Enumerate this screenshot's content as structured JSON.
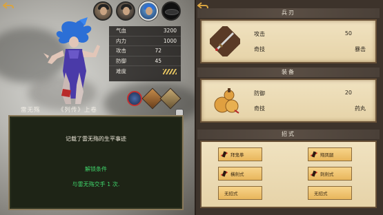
{
  "character": {
    "stats": [
      {
        "label": "气血",
        "value": "3200"
      },
      {
        "label": "内力",
        "value": "1000"
      },
      {
        "label": "攻击",
        "value": "72"
      },
      {
        "label": "防御",
        "value": "45"
      },
      {
        "label": "难度",
        "value": ""
      }
    ],
    "name": "雷无殇",
    "book": "《列传》上卷",
    "description": "记载了雷无殇的生平事迹",
    "unlock_title": "解锁条件",
    "unlock_text": "与雷无殇交手 1 次."
  },
  "portraits": [
    "portrait-1",
    "portrait-2",
    "portrait-3-selected",
    "portrait-4"
  ],
  "weapon": {
    "header": "兵刃",
    "rows": [
      {
        "label": "攻击",
        "value": "50"
      },
      {
        "label": "奇技",
        "value": "暴击"
      }
    ]
  },
  "equipment": {
    "header": "装备",
    "rows": [
      {
        "label": "防御",
        "value": "20"
      },
      {
        "label": "奇技",
        "value": "药丸"
      }
    ]
  },
  "skills": {
    "header": "招式",
    "items": [
      "拜鬼拳",
      "翔凤腿",
      "橫劍式",
      "刺劍式",
      "无招式",
      "无招式"
    ]
  },
  "icons": {
    "back": "back-arrow-icon",
    "lock": "lock-icon",
    "weapon": "sword-icon",
    "equipment": "gourd-icon"
  },
  "colors": {
    "accent": "#d9a441",
    "unlock": "#3fd46a"
  }
}
